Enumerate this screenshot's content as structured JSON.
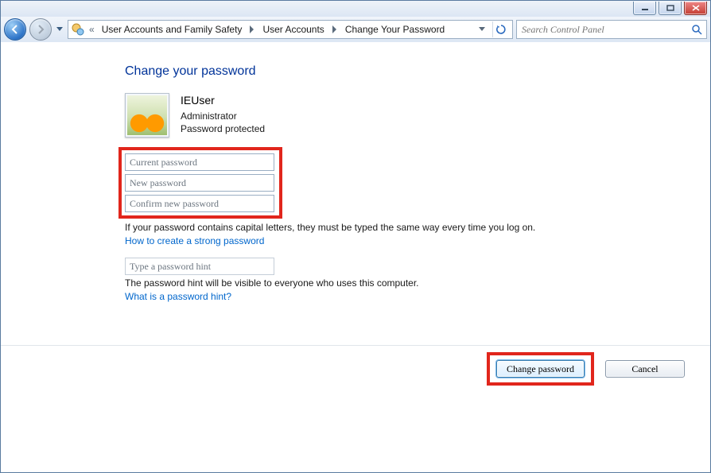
{
  "window_controls": {
    "minimize": "minimize",
    "maximize": "maximize",
    "close": "close"
  },
  "breadcrumb": {
    "items": [
      "User Accounts and Family Safety",
      "User Accounts",
      "Change Your Password"
    ]
  },
  "search": {
    "placeholder": "Search Control Panel"
  },
  "page": {
    "title": "Change your password",
    "user": {
      "name": "IEUser",
      "role": "Administrator",
      "status": "Password protected"
    },
    "inputs": {
      "current_ph": "Current password",
      "new_ph": "New password",
      "confirm_ph": "Confirm new password",
      "hint_ph": "Type a password hint"
    },
    "caps_note": "If your password contains capital letters, they must be typed the same way every time you log on.",
    "link_strong": "How to create a strong password",
    "hint_note": "The password hint will be visible to everyone who uses this computer.",
    "link_hint": "What is a password hint?"
  },
  "footer": {
    "change": "Change password",
    "cancel": "Cancel"
  }
}
